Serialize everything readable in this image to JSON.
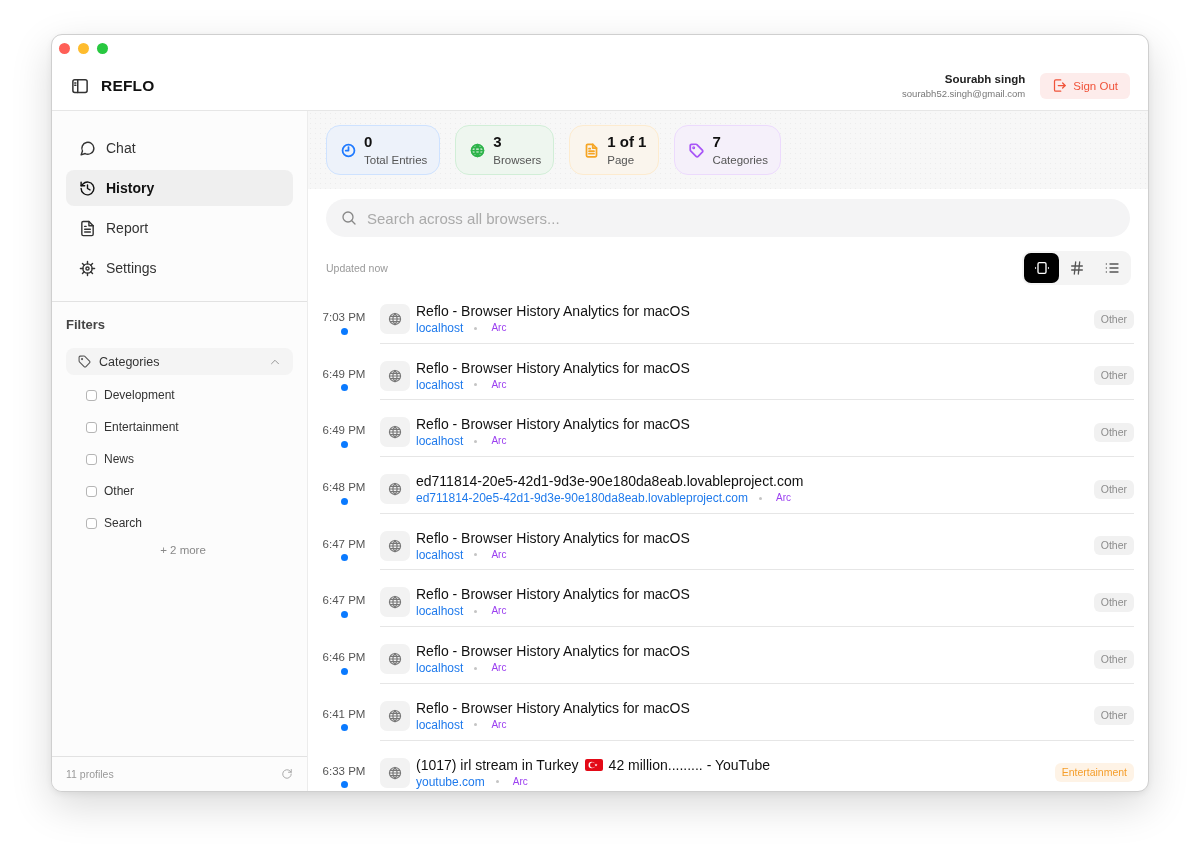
{
  "header": {
    "app_name": "REFLO",
    "user_name": "Sourabh singh",
    "user_email": "sourabh52.singh@gmail.com",
    "sign_out": "Sign Out"
  },
  "sidebar": {
    "nav": [
      {
        "kind": "chat",
        "label": "Chat",
        "selected": false
      },
      {
        "kind": "history",
        "label": "History",
        "selected": true
      },
      {
        "kind": "report",
        "label": "Report",
        "selected": false
      },
      {
        "kind": "settings",
        "label": "Settings",
        "selected": false
      }
    ],
    "filters_title": "Filters",
    "categories": {
      "label": "Categories",
      "expanded": true,
      "options": [
        {
          "label": "Development",
          "checked": false
        },
        {
          "label": "Entertainment",
          "checked": false
        },
        {
          "label": "News",
          "checked": false
        },
        {
          "label": "Other",
          "checked": false
        },
        {
          "label": "Search",
          "checked": false
        }
      ],
      "more": "+ 2 more"
    },
    "footer": "11 profiles"
  },
  "stats": [
    {
      "kind": "entries",
      "value": "0",
      "label": "Total Entries",
      "color": "#1f7aff"
    },
    {
      "kind": "browsers",
      "value": "3",
      "label": "Browsers",
      "color": "#2db34a"
    },
    {
      "kind": "page",
      "value": "1 of 1",
      "label": "Page",
      "color": "#f5a524"
    },
    {
      "kind": "categories",
      "value": "7",
      "label": "Categories",
      "color": "#a855f7"
    }
  ],
  "search": {
    "placeholder": "Search across all browsers..."
  },
  "toolbar": {
    "status": "Updated now",
    "view_modes": [
      {
        "kind": "timeline",
        "selected": true
      },
      {
        "kind": "grid",
        "selected": false
      },
      {
        "kind": "list",
        "selected": false
      }
    ]
  },
  "history": [
    {
      "time": "7:03 PM",
      "title": "Reflo - Browser History Analytics for macOS",
      "domain": "localhost",
      "browser": "Arc",
      "category": "Other",
      "color": "#8c8c8c"
    },
    {
      "time": "6:49 PM",
      "title": "Reflo - Browser History Analytics for macOS",
      "domain": "localhost",
      "browser": "Arc",
      "category": "Other",
      "color": "#8c8c8c"
    },
    {
      "time": "6:49 PM",
      "title": "Reflo - Browser History Analytics for macOS",
      "domain": "localhost",
      "browser": "Arc",
      "category": "Other",
      "color": "#8c8c8c"
    },
    {
      "time": "6:48 PM",
      "title": "ed711814-20e5-42d1-9d3e-90e180da8eab.lovableproject.com",
      "domain": "ed711814-20e5-42d1-9d3e-90e180da8eab.lovableproject.com",
      "browser": "Arc",
      "category": "Other",
      "color": "#8c8c8c"
    },
    {
      "time": "6:47 PM",
      "title": "Reflo - Browser History Analytics for macOS",
      "domain": "localhost",
      "browser": "Arc",
      "category": "Other",
      "color": "#8c8c8c"
    },
    {
      "time": "6:47 PM",
      "title": "Reflo - Browser History Analytics for macOS",
      "domain": "localhost",
      "browser": "Arc",
      "category": "Other",
      "color": "#8c8c8c"
    },
    {
      "time": "6:46 PM",
      "title": "Reflo - Browser History Analytics for macOS",
      "domain": "localhost",
      "browser": "Arc",
      "category": "Other",
      "color": "#8c8c8c"
    },
    {
      "time": "6:41 PM",
      "title": "Reflo - Browser History Analytics for macOS",
      "domain": "localhost",
      "browser": "Arc",
      "category": "Other",
      "color": "#8c8c8c"
    },
    {
      "time": "6:33 PM",
      "title": "(1017) irl stream in Turkey",
      "flag": true,
      "title_after": "42 million......... - YouTube",
      "domain": "youtube.com",
      "browser": "Arc",
      "category": "Entertainment",
      "color": "#f59e2b"
    }
  ]
}
